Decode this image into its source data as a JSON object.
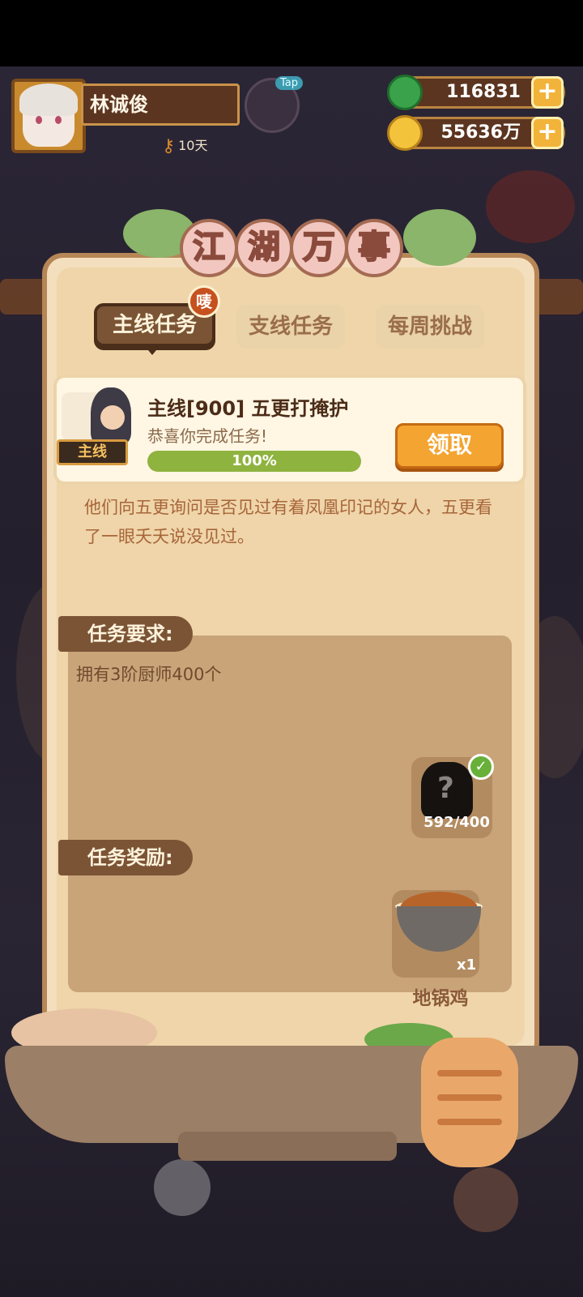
{
  "player": {
    "name": "林诚俊",
    "days": "10天"
  },
  "hud": {
    "tap_label": "Tap",
    "jade_amount": "116831",
    "coin_amount": "55636万",
    "plus": "+"
  },
  "panel": {
    "title_chars": [
      "江",
      "湖",
      "万",
      "事"
    ],
    "tabs": [
      {
        "label": "主线任务",
        "active": true
      },
      {
        "label": "支线任务",
        "active": false
      },
      {
        "label": "每周挑战",
        "active": false
      }
    ],
    "new_badge": "唛"
  },
  "quest": {
    "tag": "主线",
    "title": "主线[900] 五更打掩护",
    "subtitle": "恭喜你完成任务!",
    "progress": 1.0,
    "progress_label": "100%",
    "claim_label": "领取",
    "story": "他们向五更询问是否见过有着凤凰印记的女人，五更看了一眼夭夭说没见过。"
  },
  "requirement": {
    "header": "任务要求:",
    "text": "拥有3阶厨师400个",
    "count": "592/400",
    "question_mark": "?",
    "check": "✓"
  },
  "reward": {
    "header": "任务奖励:",
    "qty": "x1",
    "name": "地锅鸡"
  },
  "colors": {
    "panel_bg": "#f3dfbd",
    "section_bg": "#c9a479",
    "claim_button": "#f4a431",
    "progress_fill": "#8fb33f"
  }
}
